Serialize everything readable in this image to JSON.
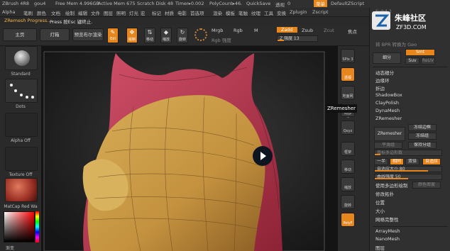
{
  "titlebar": {
    "app": "ZBrush 4R8",
    "doc": "gou4",
    "free_mem": "Free Mem 4.996GB",
    "active_mem": "Active Mem 675",
    "scratch": "Scratch Disk 48",
    "timer": "Timer▸0.002",
    "polycount": "PolyCount▸46.",
    "quicksave": "QuickSave",
    "transp_label": "透视",
    "transp_value": "0",
    "menu_btn": "菜单",
    "script": "DefaultZScript"
  },
  "menubar": [
    "Alpha",
    "笔刷",
    "颜色",
    "文档",
    "绘制",
    "编辑",
    "文件",
    "图层",
    "照明",
    "灯光",
    "宏",
    "标记",
    "材质",
    "电影",
    "首选项",
    "渲染",
    "模板",
    "笔触",
    "纹理",
    "工具",
    "变换",
    "Zplugin",
    "Zscript"
  ],
  "status": {
    "progress": "ZRemesh Progress....",
    "hint": "Press 按Esc 键终止."
  },
  "toolbar": {
    "home": "主页",
    "lightbox": "灯箱",
    "preview": "预览布尔渲染",
    "edit_sub": "Edi",
    "draw_sub": "绘制",
    "move_sub": "移动",
    "scale_sub": "缩放",
    "rotate_sub": "旋转",
    "mrgb": "Mrgb",
    "rgb": "Rgb",
    "m": "M",
    "rgb_intensity": "Rgb 强度",
    "zadd": "Zadd",
    "zsub": "Zsub",
    "zcut": "Zcut",
    "z_intensity": "Z 强度 13",
    "focal": "焦点"
  },
  "left_shelf": {
    "brush": "Standard",
    "stroke": "Dots",
    "alpha": "Alpha Off",
    "texture": "Texture Off",
    "material": "MatCap Red Wa",
    "color_label": "渐变"
  },
  "right_shelf": [
    {
      "name": "spix-icon",
      "label": "SPix 3"
    },
    {
      "name": "camera-icon",
      "label": "透视"
    },
    {
      "name": "floor-icon",
      "label": "地面网格"
    },
    {
      "name": "local-icon",
      "label": "局部"
    },
    {
      "name": "xyz-icon",
      "label": "Qxyz"
    },
    {
      "name": "frame-icon",
      "label": "框架"
    },
    {
      "name": "move-icon",
      "label": "移动"
    },
    {
      "name": "zoom-icon",
      "label": "缩放"
    },
    {
      "name": "rotate-icon",
      "label": "旋转"
    },
    {
      "name": "polyf-icon",
      "label": "PolyF"
    }
  ],
  "tooltip": "ZRemesher",
  "palette": {
    "logo_main": "朱峰社区",
    "logo_sub": "ZF3D.COM",
    "subdiv_label": "Subd 2",
    "bpr_label": "将 BPR 转换为 Geo",
    "divide": "细分",
    "smt": "Smt",
    "suv": "Suv",
    "reuv": "ReUV",
    "items": [
      "动态细分",
      "边缘环",
      "折边",
      "ShadowBox",
      "ClayPolish",
      "DynaMesh",
      "ZRemesher"
    ],
    "zremesher_btn": "ZRemesher",
    "freeze_border": "冻结边框",
    "freeze_groups": "冻结组",
    "keep_groups": "保持分组",
    "smooth_groups": "平滑组",
    "target_poly": "目标多边形数",
    "half": "一半",
    "same": "相同",
    "double": "双倍",
    "adapt": "自适应",
    "adapt_size": "自适应大小 80",
    "curve_strength": "曲线强度 50",
    "use_poly_paint": "使用多边形绘制",
    "color_density": "颜色密度",
    "items2": [
      "修改拓扑",
      "位置",
      "大小",
      "网格完整性"
    ],
    "items3": [
      "ArrayMesh",
      "NanoMesh",
      "图层"
    ]
  },
  "colors": {
    "accent": "#e8861e",
    "mesh_skin": "#c99a4a",
    "mesh_red": "#c23c4e"
  }
}
